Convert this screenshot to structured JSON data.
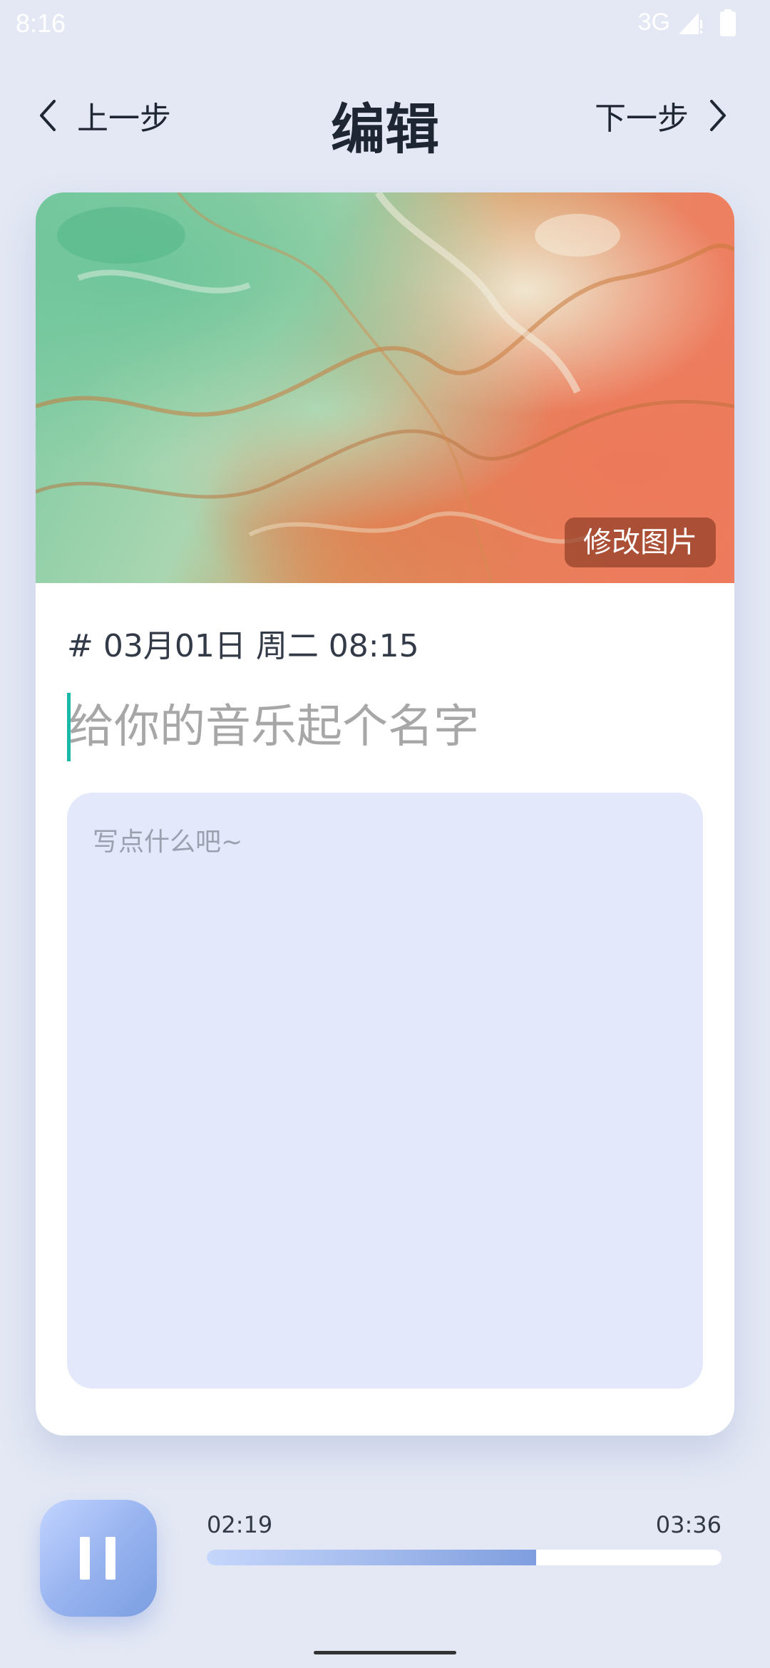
{
  "status_bar": {
    "time": "8:16",
    "network": "3G"
  },
  "header": {
    "back_label": "上一步",
    "title": "编辑",
    "next_label": "下一步"
  },
  "card": {
    "change_image_label": "修改图片",
    "date_text": "# 03月01日 周二 08:15",
    "title_placeholder": "给你的音乐起个名字",
    "content_placeholder": "写点什么吧~"
  },
  "player": {
    "current_time": "02:19",
    "total_time": "03:36",
    "progress_fraction": 0.64,
    "state": "playing"
  },
  "colors": {
    "background": "#e3e8f4",
    "accent": "#1ab8a8",
    "progress": "#9db6ea"
  }
}
